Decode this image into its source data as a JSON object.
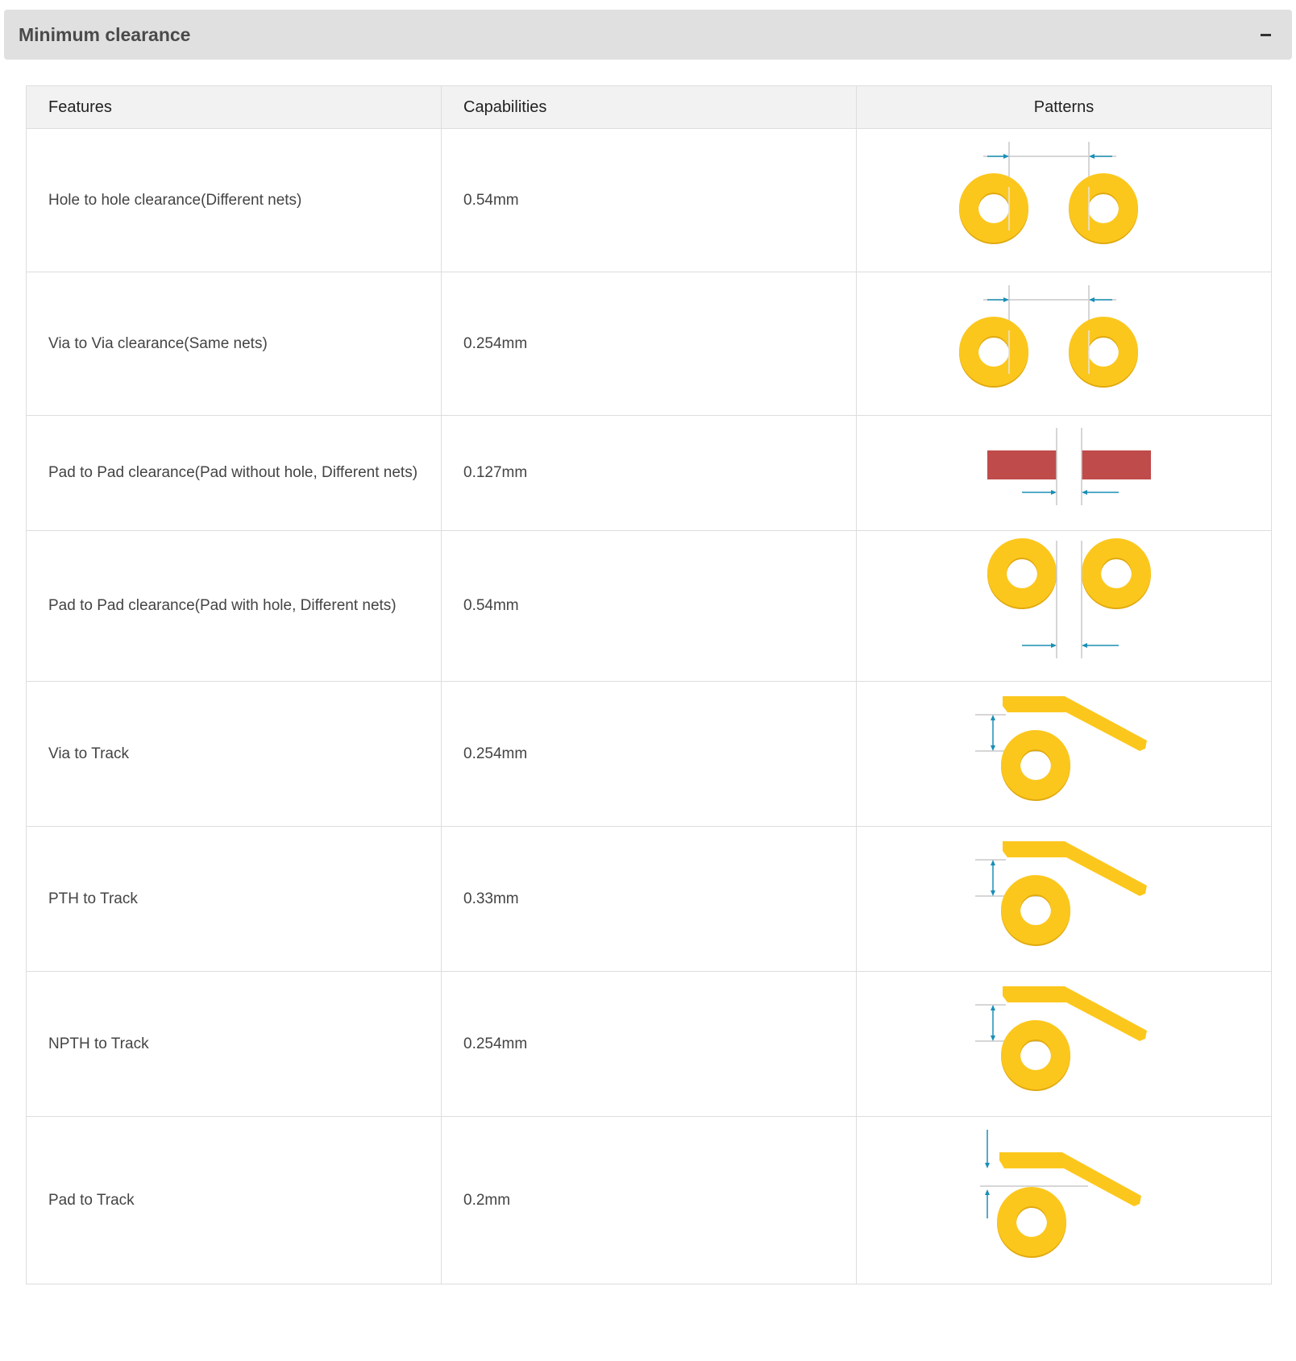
{
  "panel": {
    "title": "Minimum clearance",
    "collapse_icon": "minus-icon"
  },
  "table": {
    "headers": {
      "features": "Features",
      "capabilities": "Capabilities",
      "patterns": "Patterns"
    },
    "rows": [
      {
        "feature": "Hole to hole clearance(Different nets)",
        "capability": "0.54mm",
        "pattern": "hole-to-hole-pattern"
      },
      {
        "feature": "Via to Via clearance(Same nets)",
        "capability": "0.254mm",
        "pattern": "via-to-via-pattern"
      },
      {
        "feature": "Pad to Pad clearance(Pad without hole, Different nets)",
        "capability": "0.127mm",
        "pattern": "smd-pad-to-pad-pattern"
      },
      {
        "feature": "Pad to Pad clearance(Pad with hole, Different nets)",
        "capability": "0.54mm",
        "pattern": "pth-pad-to-pad-pattern"
      },
      {
        "feature": "Via to Track",
        "capability": "0.254mm",
        "pattern": "via-to-track-pattern"
      },
      {
        "feature": "PTH to Track",
        "capability": "0.33mm",
        "pattern": "pth-to-track-pattern"
      },
      {
        "feature": "NPTH to Track",
        "capability": "0.254mm",
        "pattern": "npth-to-track-pattern"
      },
      {
        "feature": "Pad to Track",
        "capability": "0.2mm",
        "pattern": "pad-to-track-pattern"
      }
    ]
  },
  "colors": {
    "header_bg": "#e0e0e0",
    "table_head_bg": "#f2f2f2",
    "border": "#dddddd",
    "copper_yellow": "#fcc71d",
    "copper_shadow": "#e0a90f",
    "smd_pad_red": "#c04b4b",
    "dimension_blue": "#1a8fb5",
    "guide_gray": "#c8c8c8"
  }
}
